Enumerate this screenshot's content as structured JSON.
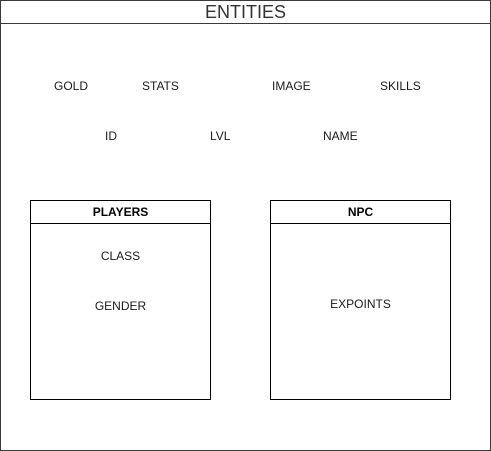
{
  "container": {
    "title": "ENTITIES",
    "attributes": [
      "GOLD",
      "STATS",
      "IMAGE",
      "SKILLS",
      "ID",
      "LVL",
      "NAME"
    ]
  },
  "players": {
    "title": "PLAYERS",
    "attributes": [
      "CLASS",
      "GENDER"
    ]
  },
  "npc": {
    "title": "NPC",
    "attributes": [
      "EXPOINTS"
    ]
  }
}
